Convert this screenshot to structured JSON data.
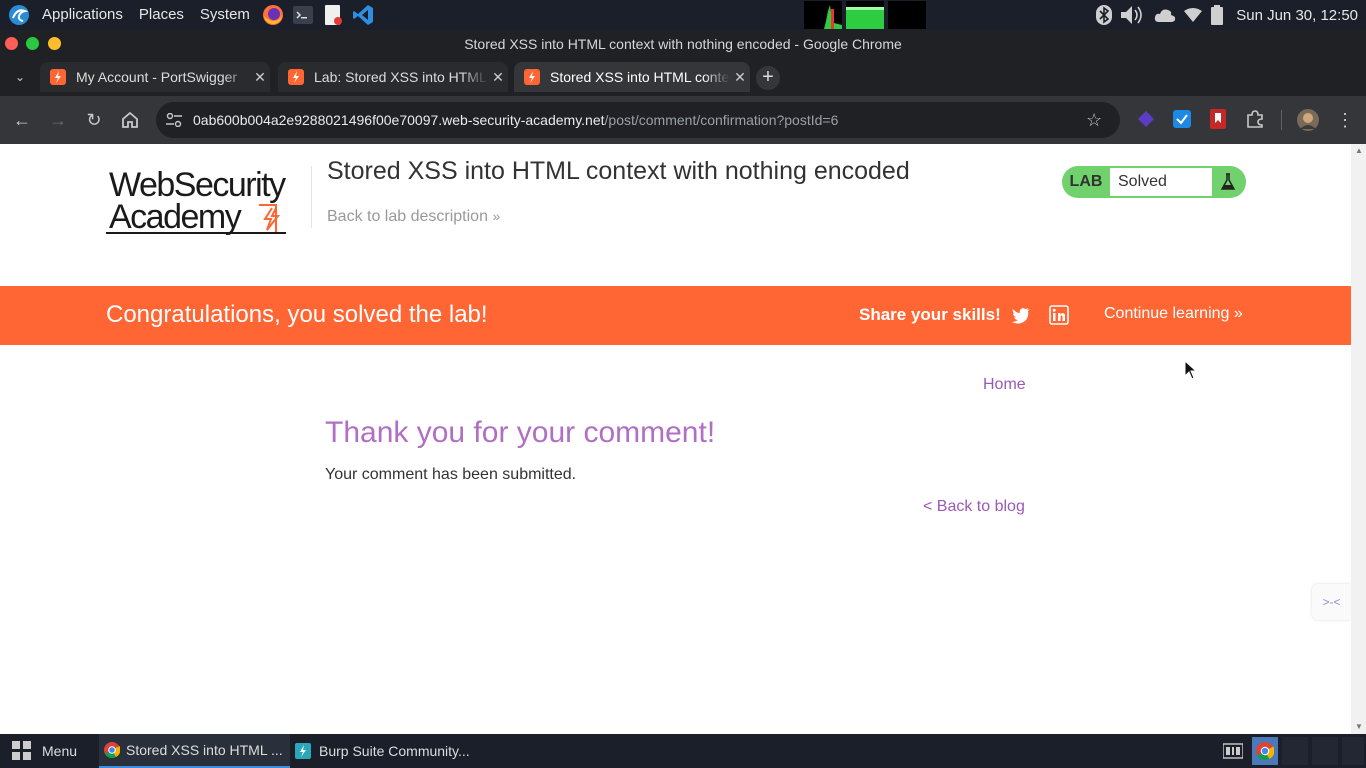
{
  "top_panel": {
    "menus": [
      "Applications",
      "Places",
      "System"
    ],
    "clock": "Sun Jun 30, 12:50"
  },
  "window": {
    "title": "Stored XSS into HTML context with nothing encoded - Google Chrome"
  },
  "tabs": [
    {
      "label": "My Account - PortSwigger",
      "active": false
    },
    {
      "label": "Lab: Stored XSS into HTML context with nothing encoded",
      "active": false
    },
    {
      "label": "Stored XSS into HTML context with nothing encoded",
      "active": true
    }
  ],
  "address_bar": {
    "domain": "0ab600b004a2e9288021496f00e70097.web-security-academy.net",
    "path": "/post/comment/confirmation?postId=6"
  },
  "lab_header": {
    "logo_line1": "WebSecurity",
    "logo_line2": "Academy",
    "title": "Stored XSS into HTML context with nothing encoded",
    "back_link": "Back to lab description",
    "status_label": "LAB",
    "status_value": "Solved"
  },
  "banner": {
    "message": "Congratulations, you solved the lab!",
    "share": "Share your skills!",
    "continue": "Continue learning"
  },
  "content": {
    "home_link": "Home",
    "heading": "Thank you for your comment!",
    "message": "Your comment has been submitted.",
    "back_link": "< Back to blog"
  },
  "taskbar": {
    "menu_label": "Menu",
    "tasks": [
      {
        "label": "Stored XSS into HTML ...",
        "active": true
      },
      {
        "label": "Burp Suite Community...",
        "active": false
      }
    ]
  },
  "colors": {
    "banner": "#ff6633",
    "lab_solved": "#70d16d",
    "link_purple": "#9b59b6"
  }
}
